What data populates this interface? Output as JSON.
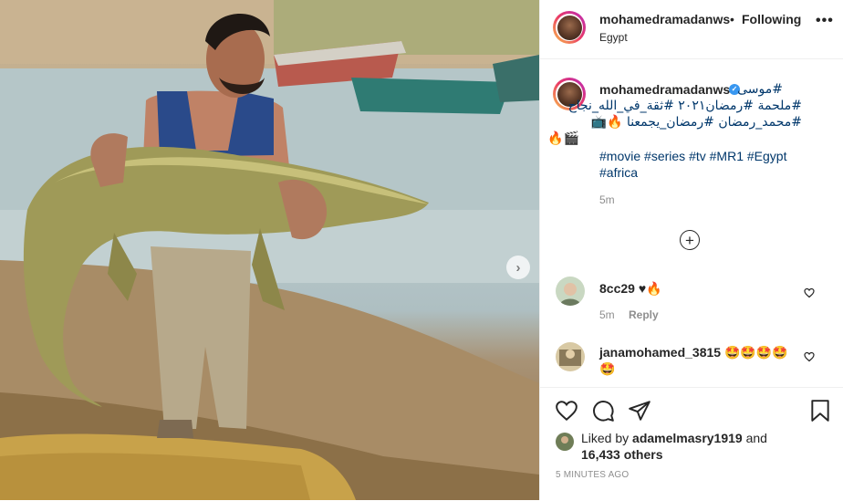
{
  "post": {
    "username": "mohamedramadanws",
    "header_separator": "•",
    "follow_status": "Following",
    "location": "Egypt",
    "more_options": "•••",
    "next_arrow": "›"
  },
  "caption": {
    "username": "mohamedramadanws",
    "verified_mark": "✓",
    "rtl_line1": "#موسى",
    "rtl_line2": "#ملحمة #رمضان٢٠٢١ #ثقة_في_الله_نجاح",
    "rtl_line3": "#محمد_رمضان #رمضان_يجمعنا 🔥📺",
    "rtl_line4": "🔥🎬",
    "tags": [
      "#movie",
      "#series",
      "#tv",
      "#MR1",
      "#Egypt",
      "#africa"
    ],
    "time": "5m",
    "load_more": "+"
  },
  "comments": [
    {
      "username": "8cc29",
      "text": "♥🔥",
      "time": "5m",
      "reply_label": "Reply"
    },
    {
      "username": "janamohamed_3815",
      "text": "🤩🤩🤩🤩 🤩"
    }
  ],
  "likes": {
    "prefix": "Liked by",
    "liker": "adamelmasry1919",
    "and": "and",
    "count": "16,433 others"
  },
  "timestamp": "5 MINUTES AGO",
  "icons": {
    "like": "heart-icon",
    "comment": "comment-icon",
    "share": "share-icon",
    "save": "bookmark-icon"
  }
}
